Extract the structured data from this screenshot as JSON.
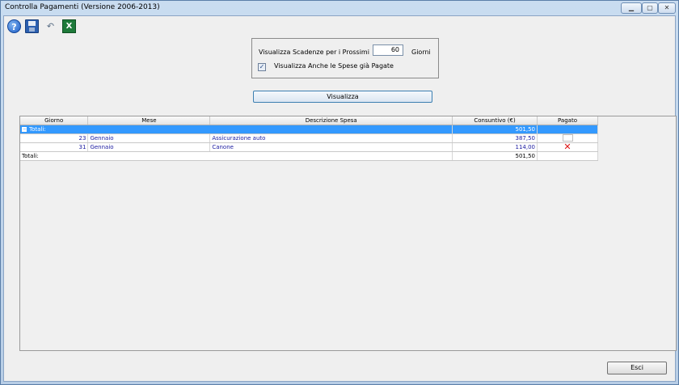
{
  "window": {
    "title": "Controlla Pagamenti (Versione 2006-2013)",
    "controls": {
      "minimize": "▁",
      "restore": "▢",
      "close": "✕"
    }
  },
  "toolbar": {
    "help_glyph": "?",
    "excel_glyph": "X",
    "undo_glyph": "↶"
  },
  "options": {
    "days_label": "Visualizza Scadenze per i Prossimi",
    "days_value": "60",
    "days_unit": "Giorni",
    "show_paid_checked": true,
    "check_glyph": "✓",
    "show_paid_label": "Visualizza Anche le Spese già Pagate"
  },
  "actions": {
    "visualizza_label": "Visualizza",
    "esci_label": "Esci"
  },
  "table": {
    "columns": [
      "Giorno",
      "Mese",
      "Descrizione Spesa",
      "Consuntivo (€)",
      "Pagato"
    ],
    "group_label": "Totali:",
    "group_expander": "−",
    "group_total": "501,50",
    "rows": [
      {
        "giorno": "23",
        "mese": "Gennaio",
        "descrizione": "Assicurazione auto",
        "consuntivo": "387,50",
        "pagato": false
      },
      {
        "giorno": "31",
        "mese": "Gennaio",
        "descrizione": "Canone",
        "consuntivo": "114,00",
        "pagato": true
      }
    ],
    "footer_label": "Totali:",
    "footer_total": "501,50",
    "paid_glyph": "✕"
  }
}
